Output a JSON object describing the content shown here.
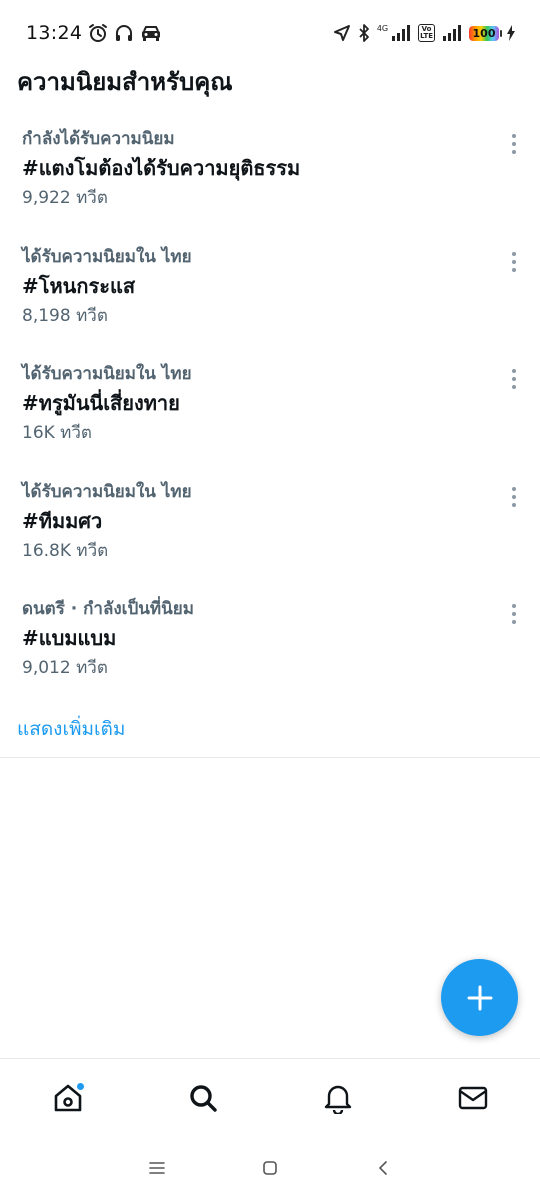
{
  "status_bar": {
    "time": "13:24",
    "network_type": "4G",
    "volte_line1": "Vo",
    "volte_line2": "LTE",
    "battery": "100",
    "icons": [
      "alarm-icon",
      "headphones-icon",
      "car-icon",
      "location-arrow-icon",
      "bluetooth-icon",
      "signal-icon",
      "charging-icon"
    ]
  },
  "header": {
    "title": "ความนิยมสำหรับคุณ"
  },
  "trends": [
    {
      "context": "กำลังได้รับความนิยม",
      "tag": "#แตงโมต้องได้รับความยุติธรรม",
      "count": "9,922 ทวีต"
    },
    {
      "context": "ได้รับความนิยมใน ไทย",
      "tag": "#โหนกระแส",
      "count": "8,198 ทวีต"
    },
    {
      "context": "ได้รับความนิยมใน ไทย",
      "tag": "#ทรูมันนี่เสี่ยงทาย",
      "count": "16K ทวีต"
    },
    {
      "context": "ได้รับความนิยมใน ไทย",
      "tag": "#ทีมมศว",
      "count": "16.8K ทวีต"
    },
    {
      "context": "ดนตรี · กำลังเป็นที่นิยม",
      "tag": "#แบมแบม",
      "count": "9,012 ทวีต"
    }
  ],
  "show_more": "แสดงเพิ่มเติม",
  "fab": {
    "icon": "plus-icon"
  },
  "bottom_nav": {
    "items": [
      "home-icon",
      "search-icon",
      "bell-icon",
      "mail-icon"
    ],
    "home_has_notification": true
  },
  "system_nav": [
    "menu-icon",
    "home-square-icon",
    "back-icon"
  ],
  "colors": {
    "accent": "#1d9bf0",
    "text_primary": "#0f1419",
    "text_secondary": "#536471",
    "divider": "#e7e9ea"
  }
}
